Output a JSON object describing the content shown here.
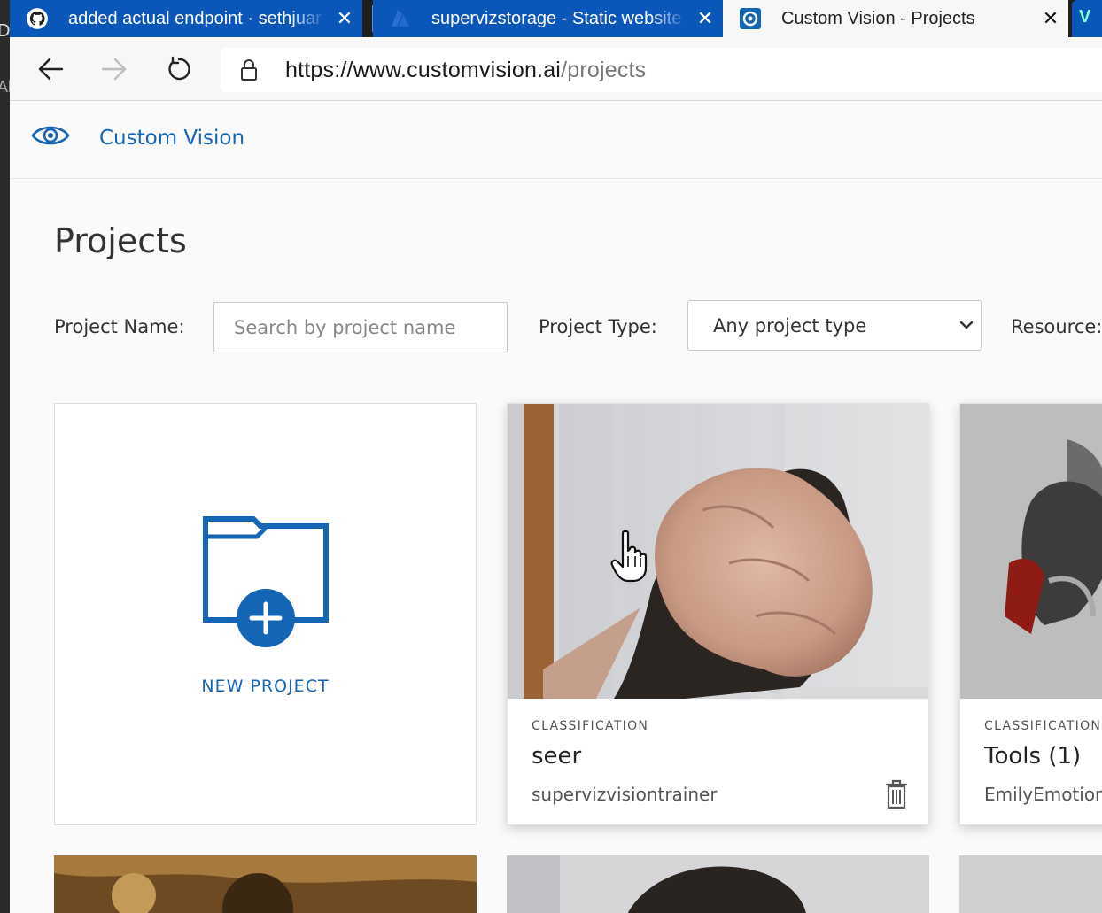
{
  "browser": {
    "tabs": [
      {
        "title": "added actual endpoint · sethjuar",
        "icon": "github-icon",
        "close": "✕"
      },
      {
        "title": "supervizstorage - Static website",
        "icon": "azure-icon",
        "close": "✕"
      },
      {
        "title": "Custom Vision - Projects",
        "icon": "custom-vision-icon",
        "close": "✕"
      }
    ],
    "extra_tab_glyph": "V",
    "url_host": "https://www.customvision.ai",
    "url_path": "/projects"
  },
  "app": {
    "brand": "Custom Vision"
  },
  "page": {
    "title": "Projects"
  },
  "filters": {
    "name_label": "Project Name:",
    "name_placeholder": "Search by project name",
    "type_label": "Project Type:",
    "type_value": "Any project type",
    "resource_label": "Resource:"
  },
  "new_project": {
    "label": "NEW PROJECT"
  },
  "projects": [
    {
      "type": "CLASSIFICATION",
      "name": "seer",
      "resource": "supervizvisiontrainer"
    },
    {
      "type": "CLASSIFICATION",
      "name": "Tools (1)",
      "resource": "EmilyEmotions"
    }
  ],
  "colors": {
    "accent": "#1565b5",
    "tab_inactive": "#0b57b9"
  }
}
